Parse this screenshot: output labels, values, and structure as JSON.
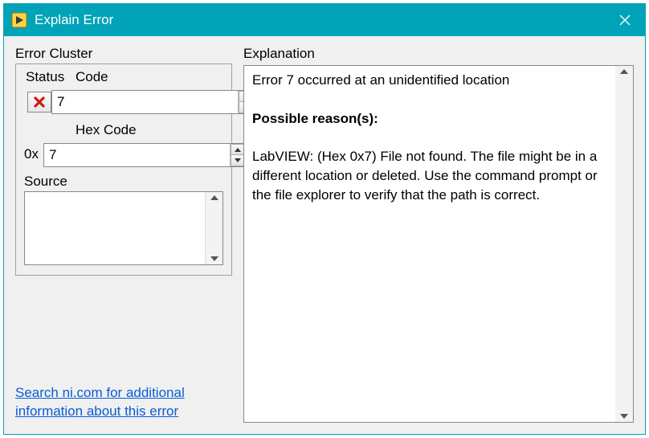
{
  "title": "Explain Error",
  "left": {
    "cluster_label": "Error Cluster",
    "status_label": "Status",
    "code_label": "Code",
    "code_value": "7",
    "hex_label": "Hex Code",
    "hex_prefix": "0x",
    "hex_value": "7",
    "source_label": "Source",
    "source_value": ""
  },
  "link_text": "Search ni.com for additional information about this error",
  "explanation_label": "Explanation",
  "explanation": {
    "line1": "Error 7 occurred at an unidentified location",
    "heading": "Possible reason(s):",
    "body": "LabVIEW: (Hex 0x7) File not found. The file might be in a different location or deleted. Use the command prompt or the file explorer to verify that the path is correct."
  }
}
